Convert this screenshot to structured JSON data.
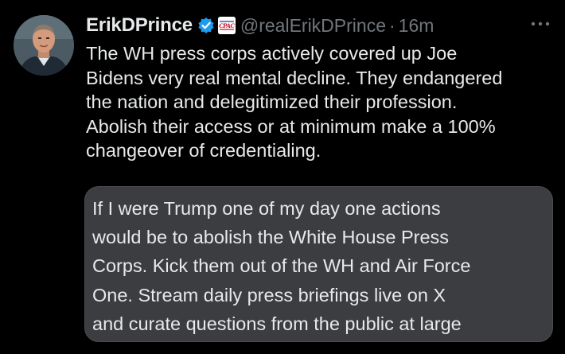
{
  "tweet": {
    "display_name": "ErikDPrince",
    "handle": "@realErikDPrince",
    "separator": "·",
    "time": "16m",
    "affiliate_badge": "CPAC",
    "body": "The WH press corps actively covered up Joe\nBidens very real mental decline. They endangered\nthe nation and delegitimized their profession.\nAbolish their access or at minimum make a 100%\nchangeover of credentialing.",
    "quote": "If I were Trump one of my day one actions\nwould be to abolish the White House Press\nCorps. Kick them out of the WH and Air Force\nOne. Stream daily press briefings live on X\nand curate questions from the public at large"
  },
  "icons": {
    "verified": "verified-badge-icon",
    "affiliate": "cpac-affiliate-icon",
    "more": "more-options-icon"
  },
  "colors": {
    "background": "#000000",
    "text_primary": "#e7e9ea",
    "text_secondary": "#71767b",
    "verified_blue": "#1d9bf0",
    "quote_background": "#3b3d40"
  }
}
